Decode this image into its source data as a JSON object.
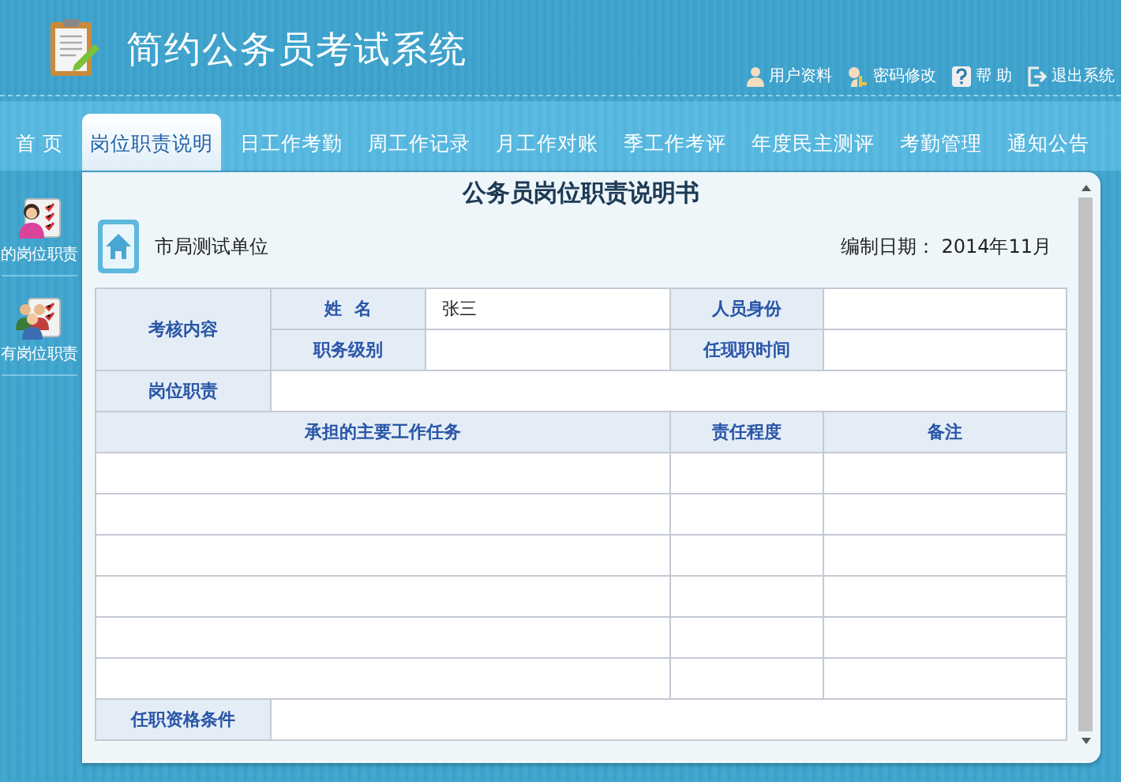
{
  "app_title": "简约公务员考试系统",
  "user_links": [
    {
      "kind": "user",
      "label": "用户资料"
    },
    {
      "kind": "key",
      "label": "密码修改"
    },
    {
      "kind": "help",
      "label": "帮 助"
    },
    {
      "kind": "exit",
      "label": "退出系统"
    }
  ],
  "tabs": [
    {
      "label": "首 页",
      "selected": false
    },
    {
      "label": "岗位职责说明",
      "selected": true
    },
    {
      "label": "日工作考勤",
      "selected": false
    },
    {
      "label": "周工作记录",
      "selected": false
    },
    {
      "label": "月工作对账",
      "selected": false
    },
    {
      "label": "季工作考评",
      "selected": false
    },
    {
      "label": "年度民主测评",
      "selected": false
    },
    {
      "label": "考勤管理",
      "selected": false
    },
    {
      "label": "通知公告",
      "selected": false
    }
  ],
  "sidebar": {
    "items": [
      {
        "kind": "single",
        "label": "的岗位职责"
      },
      {
        "kind": "group",
        "label": "有岗位职责"
      }
    ]
  },
  "document": {
    "title": "公务员岗位职责说明书",
    "unit": "市局测试单位",
    "date_label": "编制日期：",
    "date": "2014年11月"
  },
  "form": {
    "group_label": "考核内容",
    "fields": [
      {
        "label": "姓  名",
        "value": "张三"
      },
      {
        "label": "人员身份"
      },
      {
        "label": "职务级别"
      },
      {
        "label": "任现职时间"
      }
    ],
    "duty_label": "岗位职责",
    "task_columns": [
      "承担的主要工作任务",
      "责任程度",
      "备注"
    ],
    "qualification_label": "任职资格条件"
  }
}
